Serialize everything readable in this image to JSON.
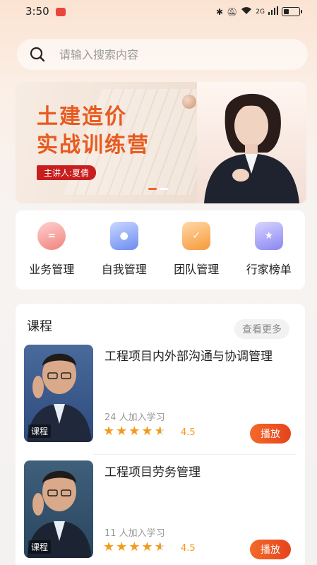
{
  "status_bar": {
    "time": "3:50",
    "network": "2G",
    "battery_level": 0.3
  },
  "search": {
    "placeholder": "请输入搜索内容"
  },
  "banner": {
    "title_line1": "土建造价",
    "title_line2": "实战训练营",
    "speaker": "主讲人:夏倩",
    "slide_count": 2,
    "active_slide": 1
  },
  "quick_menu": [
    {
      "label": "业务管理",
      "icon": "business-icon",
      "color": "#f0837c"
    },
    {
      "label": "自我管理",
      "icon": "self-icon",
      "color": "#6d8cf0"
    },
    {
      "label": "团队管理",
      "icon": "team-icon",
      "color": "#f69a3a"
    },
    {
      "label": "行家榜单",
      "icon": "ranking-icon",
      "color": "#8a86f2"
    }
  ],
  "courses_section": {
    "title": "课程",
    "more_label": "查看更多",
    "items": [
      {
        "title": "工程项目内外部沟通与协调管理",
        "learners": "24 人加入学习",
        "rating": "4.5",
        "tag": "课程",
        "play_label": "播放"
      },
      {
        "title": "工程项目劳务管理",
        "learners": "11 人加入学习",
        "rating": "4.5",
        "tag": "课程",
        "play_label": "播放"
      }
    ]
  },
  "colors": {
    "accent": "#e8682d",
    "star": "#f39a1d",
    "speaker_badge": "#c81e1e"
  }
}
